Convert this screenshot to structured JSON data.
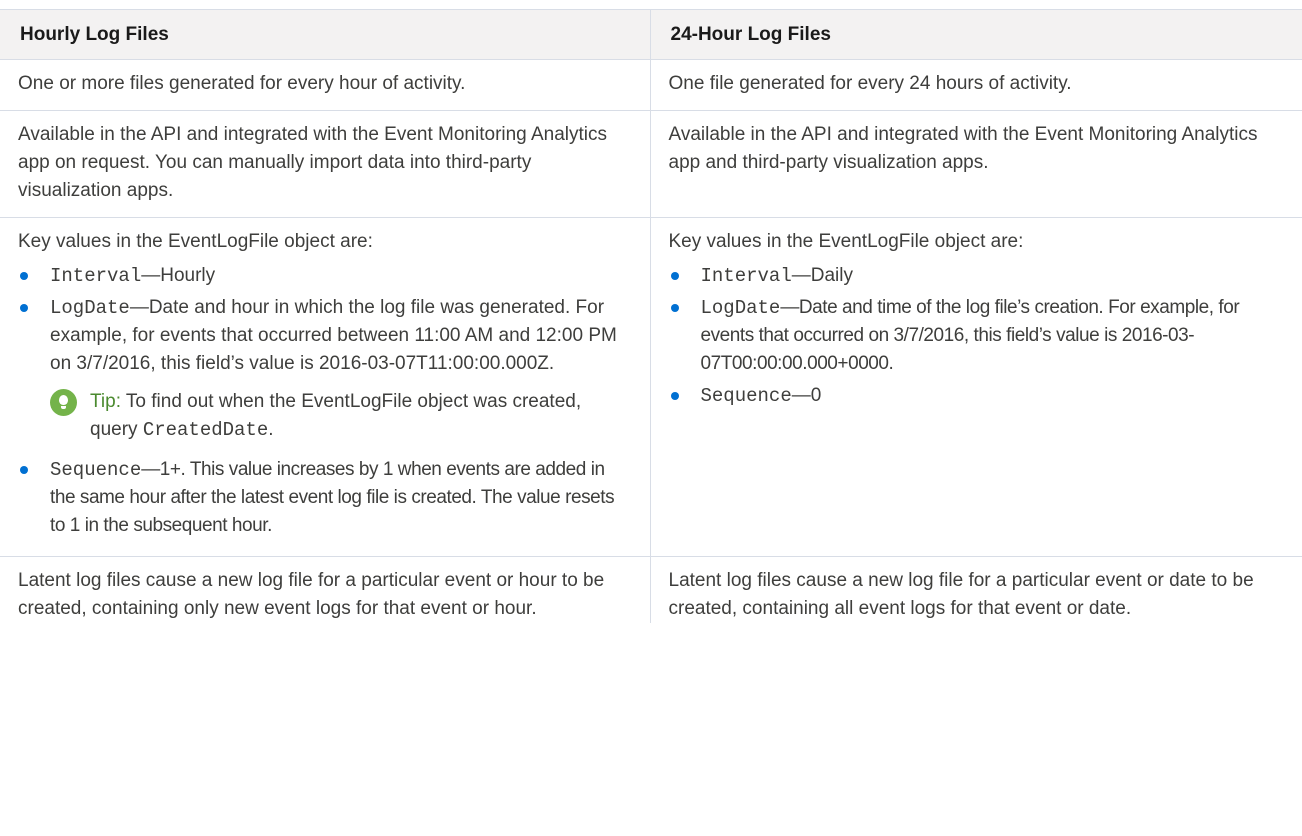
{
  "headers": {
    "hourly": "Hourly Log Files",
    "daily": "24-Hour Log Files"
  },
  "rows": {
    "generation": {
      "hourly": "One or more files generated for every hour of activity.",
      "daily": "One file generated for every 24 hours of activity."
    },
    "availability": {
      "hourly": "Available in the API and integrated with the Event Monitoring Analytics app on request. You can manually import data into third-party visualization apps.",
      "daily": "Available in the API and integrated with the Event Monitoring Analytics app and third-party visualization apps."
    },
    "key_values": {
      "intro": "Key values in the EventLogFile object are:",
      "hourly": {
        "interval_field": "Interval",
        "interval_value": "—Hourly",
        "logdate_field": "LogDate",
        "logdate_value": "—Date and hour in which the log file was generated. For example, for events that occurred between 11:00 AM and 12:00 PM on 3/7/2016, this field’s value is 2016-03-07T11:00:00.000Z.",
        "tip_label": "Tip:",
        "tip_text": " To find out when the EventLogFile object was created, query ",
        "tip_code": "CreatedDate",
        "tip_end": ".",
        "sequence_field": "Sequence",
        "sequence_value": "—1+. This value increases by 1 when events are added in the same hour after the latest event log file is created. The value resets to 1 in the subsequent hour."
      },
      "daily": {
        "interval_field": "Interval",
        "interval_value": "—Daily",
        "logdate_field": "LogDate",
        "logdate_value": "—Date and time of the log file’s creation. For example, for events that occurred on 3/7/2016, this field’s value is 2016-03-07T00:00:00.000+0000.",
        "sequence_field": "Sequence",
        "sequence_value": "—0"
      }
    },
    "latent": {
      "hourly": "Latent log files cause a new log file for a particular event or hour to be created, containing only new event logs for that event or hour.",
      "daily": "Latent log files cause a new log file for a particular event or date to be created, containing all event logs for that event or date."
    }
  },
  "colors": {
    "bullet": "#0070d2",
    "tip_icon": "#74b34a",
    "header_bg": "#f3f2f2",
    "border": "#d8dde6"
  },
  "icons": {
    "bullet": "bullet-icon",
    "tip": "lightbulb-icon"
  }
}
